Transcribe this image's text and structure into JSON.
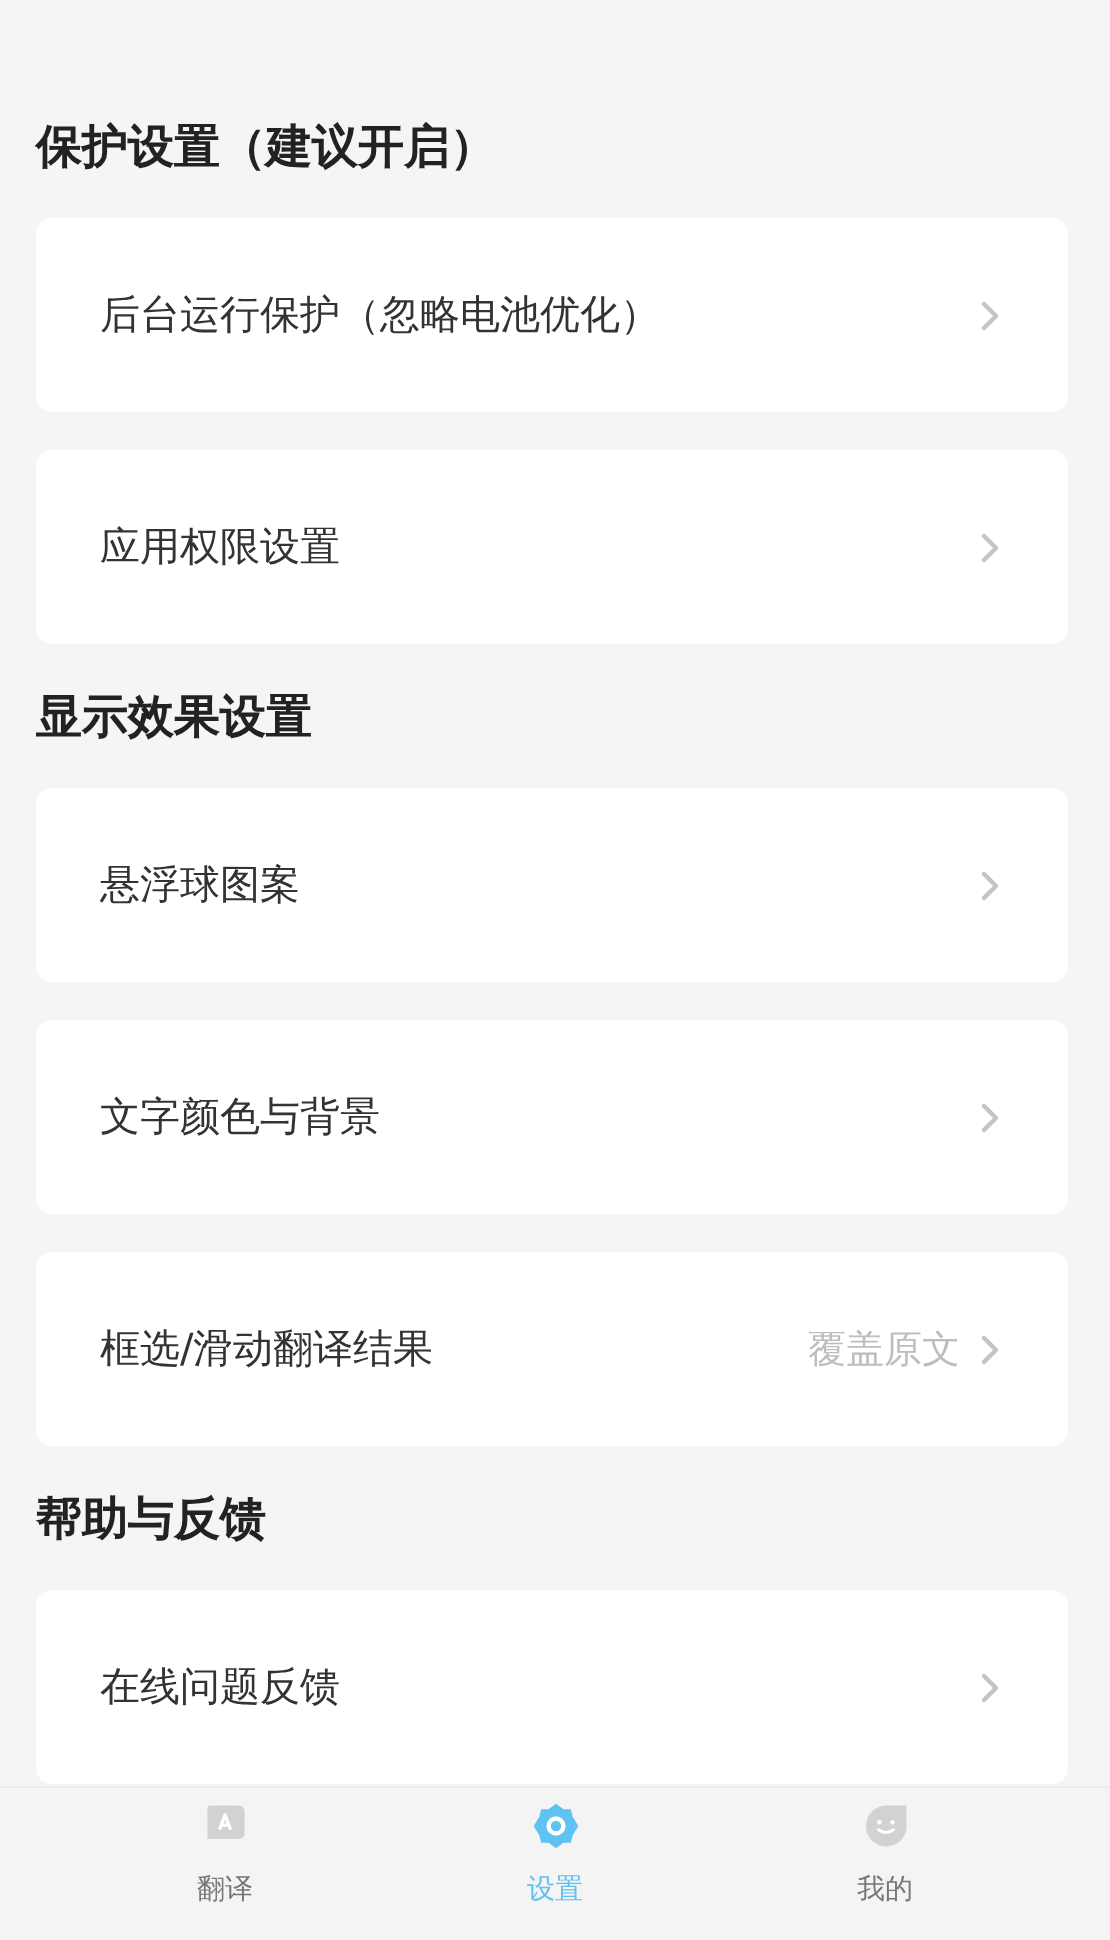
{
  "sections": [
    {
      "title": "保护设置（建议开启）",
      "items": [
        {
          "label": "后台运行保护（忽略电池优化）"
        },
        {
          "label": "应用权限设置"
        }
      ]
    },
    {
      "title": "显示效果设置",
      "items": [
        {
          "label": "悬浮球图案"
        },
        {
          "label": "文字颜色与背景"
        },
        {
          "label": "框选/滑动翻译结果",
          "value": "覆盖原文"
        }
      ]
    },
    {
      "title": "帮助与反馈",
      "items": [
        {
          "label": "在线问题反馈"
        }
      ]
    }
  ],
  "tab_bar": [
    {
      "label": "翻译",
      "kind": "translate",
      "selected": false
    },
    {
      "label": "设置",
      "kind": "settings",
      "selected": true
    },
    {
      "label": "我的",
      "kind": "profile",
      "selected": false
    }
  ]
}
